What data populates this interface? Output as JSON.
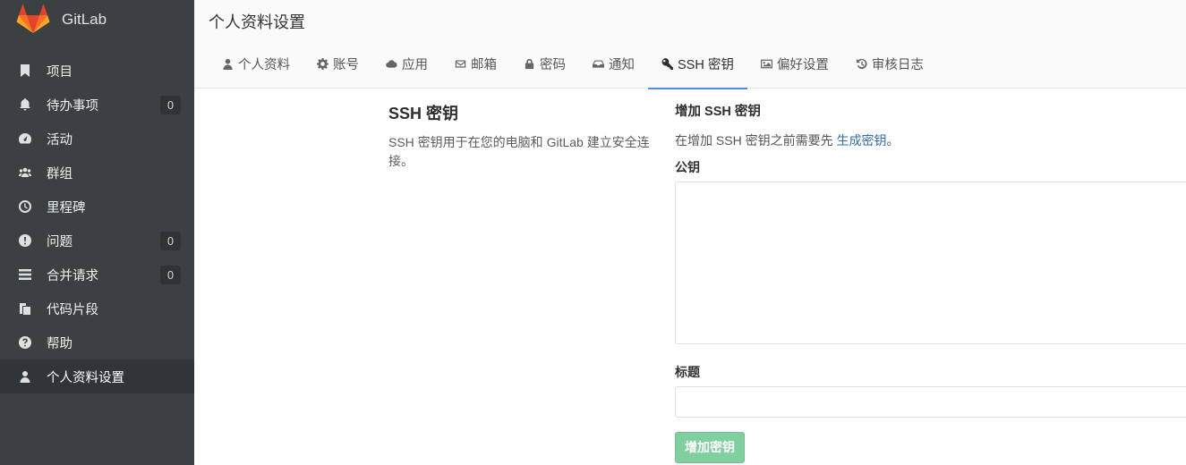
{
  "app": {
    "name": "GitLab"
  },
  "sidebar": {
    "items": [
      {
        "label": "项目",
        "icon": "bookmark-icon"
      },
      {
        "label": "待办事项",
        "icon": "bell-icon",
        "badge": "0"
      },
      {
        "label": "活动",
        "icon": "dashboard-icon"
      },
      {
        "label": "群组",
        "icon": "users-icon"
      },
      {
        "label": "里程碑",
        "icon": "clock-icon"
      },
      {
        "label": "问题",
        "icon": "exclamation-circle-icon",
        "badge": "0"
      },
      {
        "label": "合并请求",
        "icon": "list-icon",
        "badge": "0"
      },
      {
        "label": "代码片段",
        "icon": "clipboard-icon"
      },
      {
        "label": "帮助",
        "icon": "question-circle-icon"
      },
      {
        "label": "个人资料设置",
        "icon": "user-icon",
        "active": true
      }
    ]
  },
  "header": {
    "title": "个人资料设置",
    "tabs": [
      {
        "label": "个人资料",
        "icon": "user-icon"
      },
      {
        "label": "账号",
        "icon": "gear-icon"
      },
      {
        "label": "应用",
        "icon": "cloud-icon"
      },
      {
        "label": "邮箱",
        "icon": "envelope-icon"
      },
      {
        "label": "密码",
        "icon": "lock-icon"
      },
      {
        "label": "通知",
        "icon": "inbox-icon"
      },
      {
        "label": "SSH 密钥",
        "icon": "key-icon",
        "active": true
      },
      {
        "label": "偏好设置",
        "icon": "image-icon"
      },
      {
        "label": "审核日志",
        "icon": "history-icon"
      }
    ]
  },
  "main": {
    "section_title": "SSH 密钥",
    "section_desc": "SSH 密钥用于在您的电脑和 GitLab 建立安全连接。",
    "form": {
      "heading": "增加 SSH 密钥",
      "hint_prefix": "在增加 SSH 密钥之前需要先 ",
      "hint_link": "生成密钥",
      "hint_suffix": "。",
      "key_label": "公钥",
      "key_value": "",
      "title_label": "标题",
      "title_value": "",
      "submit_label": "增加密钥"
    }
  },
  "colors": {
    "sidebar_bg": "#3b4043",
    "active_tab_underline": "#4a90e2",
    "link": "#2f6fb0",
    "submit_bg": "#7fcf9f"
  }
}
